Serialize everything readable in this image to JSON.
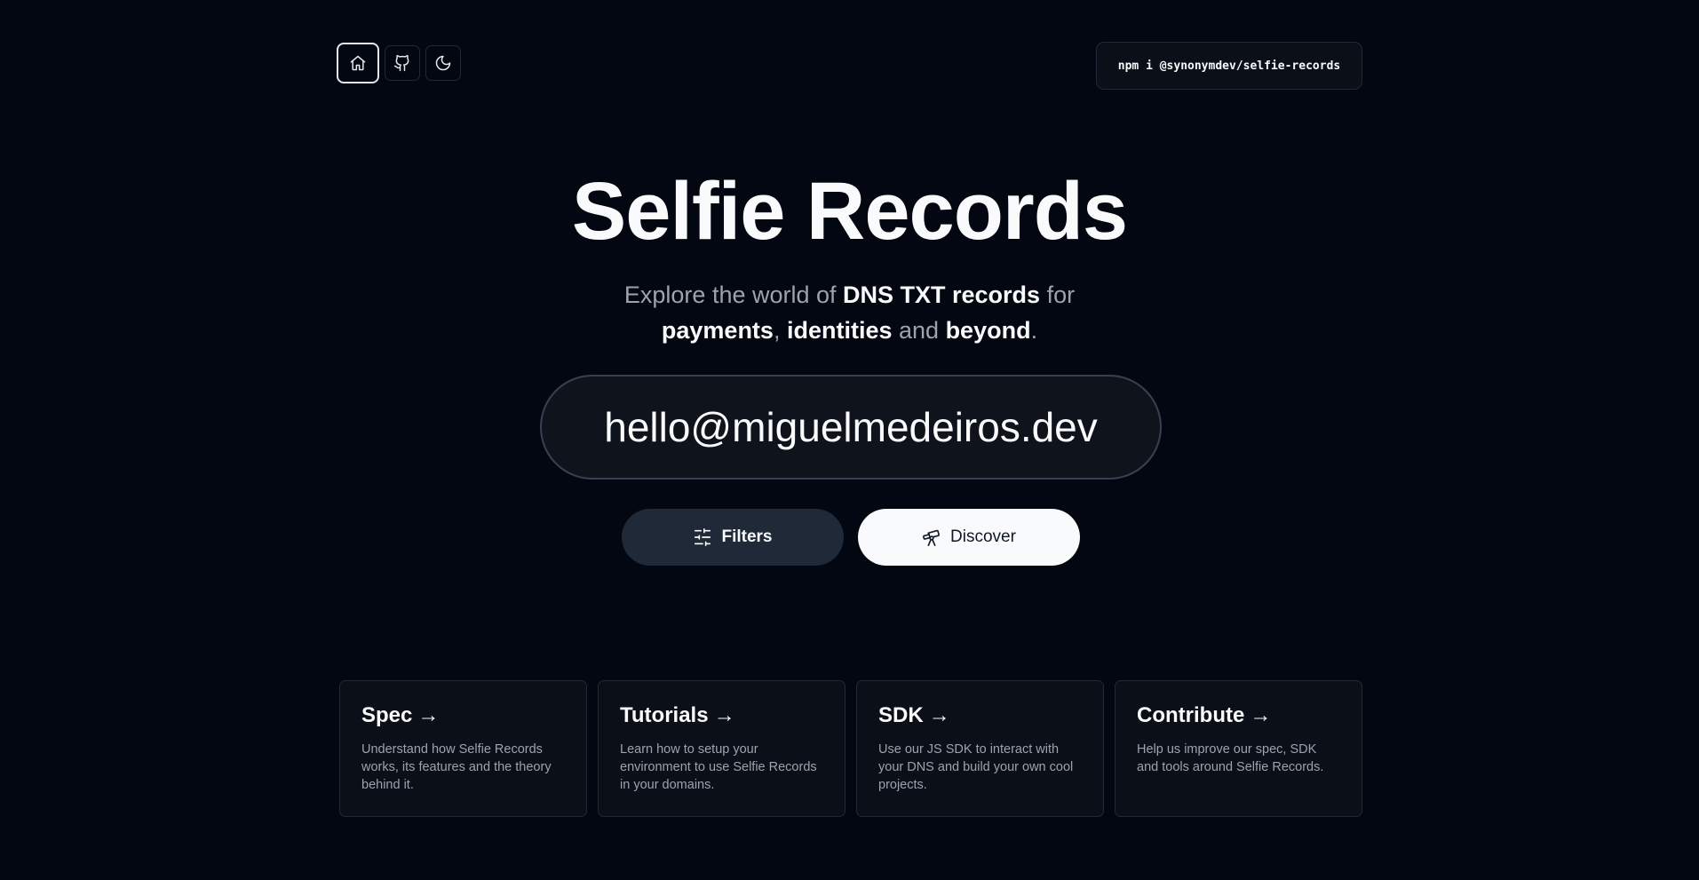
{
  "nav": {
    "home_icon": "home-icon",
    "github_icon": "github-icon",
    "theme_icon": "moon-icon"
  },
  "npm_command": "npm i @synonymdev/selfie-records",
  "hero": {
    "title": "Selfie Records",
    "subtitle": {
      "part1": "Explore the world of ",
      "bold1": "DNS TXT records",
      "part2": " for",
      "bold2": "payments",
      "part3": ", ",
      "bold3": "identities",
      "part4": " and ",
      "bold4": "beyond",
      "part5": "."
    }
  },
  "search": {
    "value": "hello@miguelmedeiros.dev"
  },
  "actions": {
    "filters_label": "Filters",
    "discover_label": "Discover"
  },
  "cards": [
    {
      "title": "Spec",
      "arrow": "→",
      "description": "Understand how Selfie Records works, its features and the theory behind it."
    },
    {
      "title": "Tutorials",
      "arrow": "→",
      "description": "Learn how to setup your environment to use Selfie Records in your domains."
    },
    {
      "title": "SDK",
      "arrow": "→",
      "description": "Use our JS SDK to interact with your DNS and build your own cool projects."
    },
    {
      "title": "Contribute",
      "arrow": "→",
      "description": "Help us improve our spec, SDK and tools around Selfie Records."
    }
  ],
  "colors": {
    "background": "#030712",
    "card_background": "#0b0f17",
    "filters_button": "#1f2937",
    "discover_button": "#f9fafb"
  }
}
